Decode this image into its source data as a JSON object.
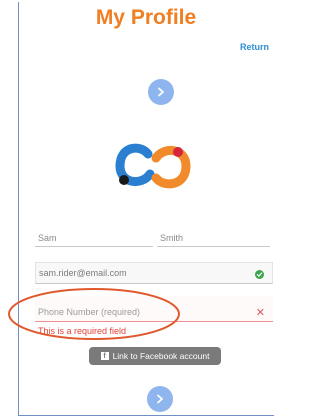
{
  "header": {
    "title": "My Profile",
    "return_label": "Return"
  },
  "form": {
    "first_name": "Sam",
    "last_name": "Smith",
    "email": "sam.rider@email.com",
    "phone_placeholder": "Phone Number (required)",
    "phone_error": "This is a required field",
    "facebook_label": "Link to Facebook account"
  },
  "colors": {
    "title": "#f07e22",
    "accent_blue": "#2f8fd3",
    "button_circle": "#8fb5ef",
    "error": "#e0433b",
    "logo_blue": "#2a7fd0",
    "logo_orange": "#f08a2a",
    "logo_red": "#d6243a"
  },
  "icons": {
    "next_top": "chevron-right-icon",
    "next_bottom": "chevron-right-icon",
    "email_status": "check-icon",
    "phone_status": "close-icon",
    "facebook": "facebook-icon"
  }
}
